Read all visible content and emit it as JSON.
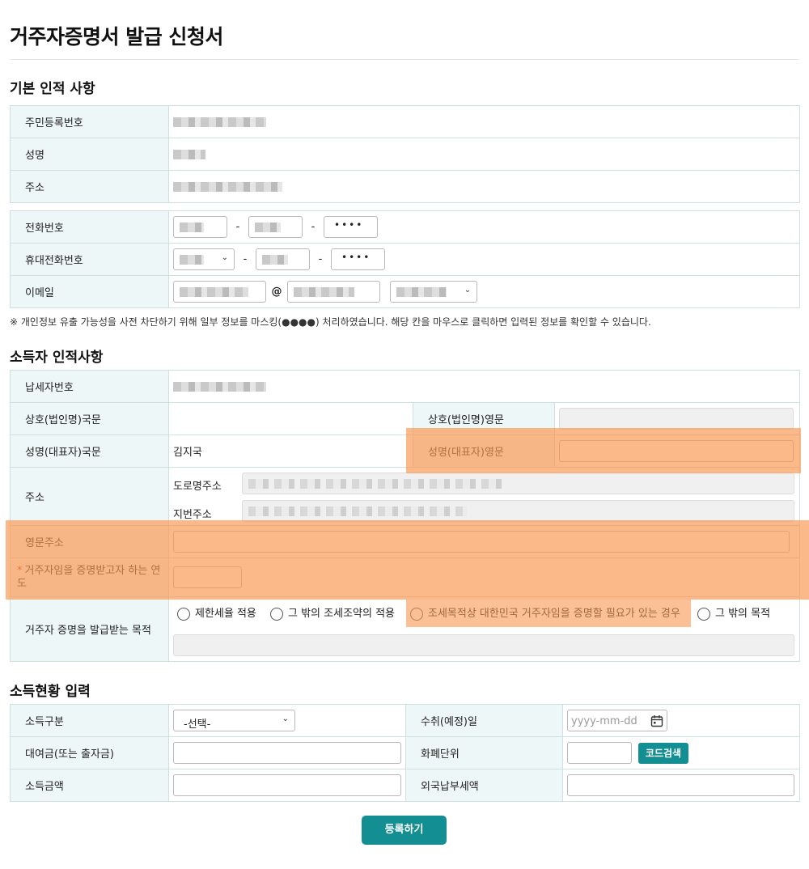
{
  "page_title": "거주자증명서 발급 신청서",
  "sections": {
    "basic": "기본 인적 사항",
    "income_person": "소득자 인적사항",
    "income_status": "소득현황 입력"
  },
  "basic": {
    "resident_no_label": "주민등록번호",
    "name_label": "성명",
    "address_label": "주소",
    "phone_label": "전화번호",
    "mobile_label": "휴대전화번호",
    "email_label": "이메일",
    "phone_last": "••••",
    "mobile_last": "••••",
    "at": "@",
    "dash": "-"
  },
  "mask_note": "※ 개인정보 유출 가능성을 사전 차단하기 위해 일부 정보를 마스킹(●●●●) 처리하였습니다. 해당 칸을 마우스로 클릭하면 입력된 정보를 확인할 수 있습니다.",
  "income_person": {
    "taxpayer_no_label": "납세자번호",
    "company_ko_label": "상호(법인명)국문",
    "company_en_label": "상호(법인명)영문",
    "rep_ko_label": "성명(대표자)국문",
    "rep_ko_value": "김지국",
    "rep_en_label": "성명(대표자)영문",
    "address_label": "주소",
    "road_addr_label": "도로명주소",
    "lot_addr_label": "지번주소",
    "en_addr_label": "영문주소",
    "year_label": "거주자임을 증명받고자 하는 연도",
    "year_required_mark": "*",
    "purpose_label": "거주자 증명을 발급받는 목적",
    "purpose_options": [
      "제한세율 적용",
      "그 밖의 조세조약의 적용",
      "조세목적상 대한민국 거주자임을 증명할 필요가 있는 경우",
      "그 밖의 목적"
    ]
  },
  "income_status": {
    "income_type_label": "소득구분",
    "income_type_value": "-선택-",
    "receipt_date_label": "수취(예정)일",
    "receipt_date_placeholder": "yyyy-mm-dd",
    "loan_label": "대여금(또는 출자금)",
    "currency_label": "화폐단위",
    "code_search_button": "코드검색",
    "amount_label": "소득금액",
    "foreign_tax_label": "외국납부세액"
  },
  "submit_button": "등록하기",
  "colors": {
    "accent": "#138f93",
    "label_bg": "#eef7f7",
    "border": "#cfe0e0",
    "highlight": "#f99650"
  }
}
